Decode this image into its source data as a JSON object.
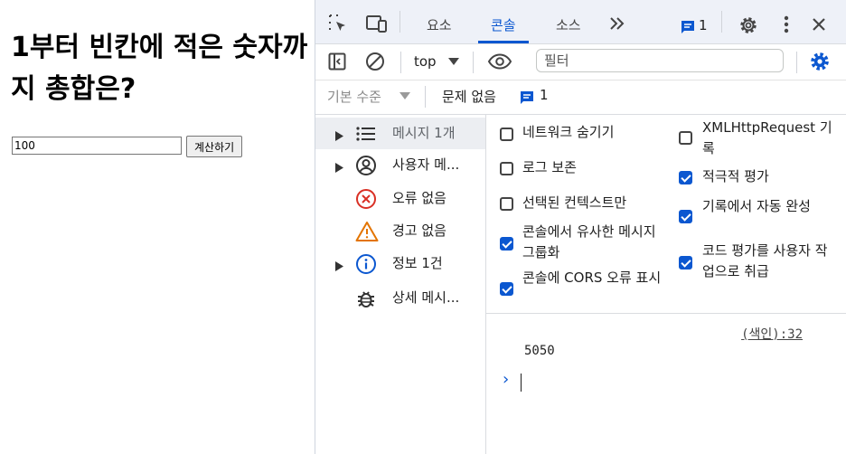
{
  "page": {
    "heading": "1부터 빈칸에 적은 숫자까지 총합은?",
    "input_value": "100",
    "button_label": "계산하기"
  },
  "devtools": {
    "tabs": [
      {
        "label": "요소",
        "active": false
      },
      {
        "label": "콘솔",
        "active": true
      },
      {
        "label": "소스",
        "active": false
      }
    ],
    "more_tabs_icon": "double-chevron-icon",
    "issues_badge_count": "1",
    "toolbar": {
      "context": "top",
      "filter_placeholder": "필터"
    },
    "level_bar": {
      "levels_label": "기본 수준",
      "issues_label": "문제 없음",
      "issues_count": "1"
    },
    "sidebar": [
      {
        "label": "메시지 1개",
        "icon": "list-icon",
        "expandable": true
      },
      {
        "label": "사용자 메...",
        "icon": "user-icon",
        "expandable": true
      },
      {
        "label": "오류 없음",
        "icon": "error-icon",
        "expandable": false
      },
      {
        "label": "경고 없음",
        "icon": "warning-icon",
        "expandable": false
      },
      {
        "label": "정보 1건",
        "icon": "info-icon",
        "expandable": true
      },
      {
        "label": "상세 메시...",
        "icon": "bug-icon",
        "expandable": false
      }
    ],
    "settings_left": [
      {
        "label": "네트워크 숨기기",
        "checked": false
      },
      {
        "label": "로그 보존",
        "checked": false
      },
      {
        "label": "선택된 컨텍스트만",
        "checked": false
      },
      {
        "label": "콘솔에서 유사한 메시지 그룹화",
        "checked": true
      },
      {
        "label": "콘솔에 CORS 오류 표시",
        "checked": true
      }
    ],
    "settings_right": [
      {
        "label": "XMLHttpRequest 기록",
        "checked": false
      },
      {
        "label": "적극적 평가",
        "checked": true
      },
      {
        "label": "기록에서 자동 완성",
        "checked": true
      },
      {
        "label": "코드 평가를 사용자 작업으로 취급",
        "checked": true
      }
    ],
    "console": {
      "source_link": "(색인):32",
      "output": "5050",
      "prompt": "›"
    },
    "colors": {
      "accent": "#0b57d0",
      "error": "#d93025",
      "warning": "#e37400"
    }
  }
}
